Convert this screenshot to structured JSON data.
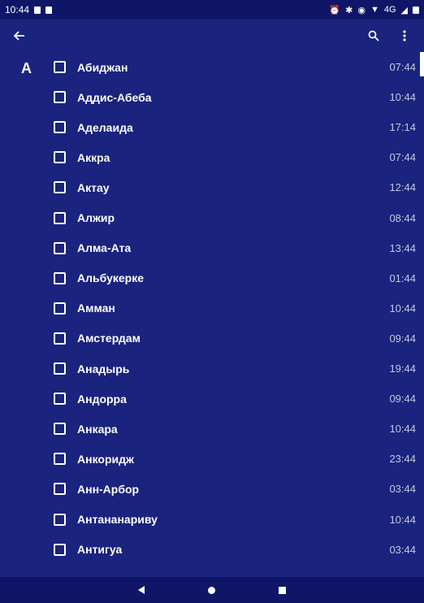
{
  "status_bar": {
    "time": "10:44",
    "network_label": "4G"
  },
  "toolbar": {
    "back_icon": "arrow-back-icon",
    "search_icon": "search-icon",
    "overflow_icon": "more-vert-icon"
  },
  "list": {
    "section_letter": "A",
    "items": [
      {
        "city": "Абиджан",
        "time": "07:44"
      },
      {
        "city": "Аддис-Абеба",
        "time": "10:44"
      },
      {
        "city": "Аделаида",
        "time": "17:14"
      },
      {
        "city": "Аккра",
        "time": "07:44"
      },
      {
        "city": "Актау",
        "time": "12:44"
      },
      {
        "city": "Алжир",
        "time": "08:44"
      },
      {
        "city": "Алма-Ата",
        "time": "13:44"
      },
      {
        "city": "Альбукерке",
        "time": "01:44"
      },
      {
        "city": "Амман",
        "time": "10:44"
      },
      {
        "city": "Амстердам",
        "time": "09:44"
      },
      {
        "city": "Анадырь",
        "time": "19:44"
      },
      {
        "city": "Андорра",
        "time": "09:44"
      },
      {
        "city": "Анкара",
        "time": "10:44"
      },
      {
        "city": "Анкоридж",
        "time": "23:44"
      },
      {
        "city": "Анн-Арбор",
        "time": "03:44"
      },
      {
        "city": "Антананариву",
        "time": "10:44"
      },
      {
        "city": "Антигуа",
        "time": "03:44"
      }
    ]
  },
  "colors": {
    "background": "#1a237e",
    "bars": "#0f1668"
  }
}
